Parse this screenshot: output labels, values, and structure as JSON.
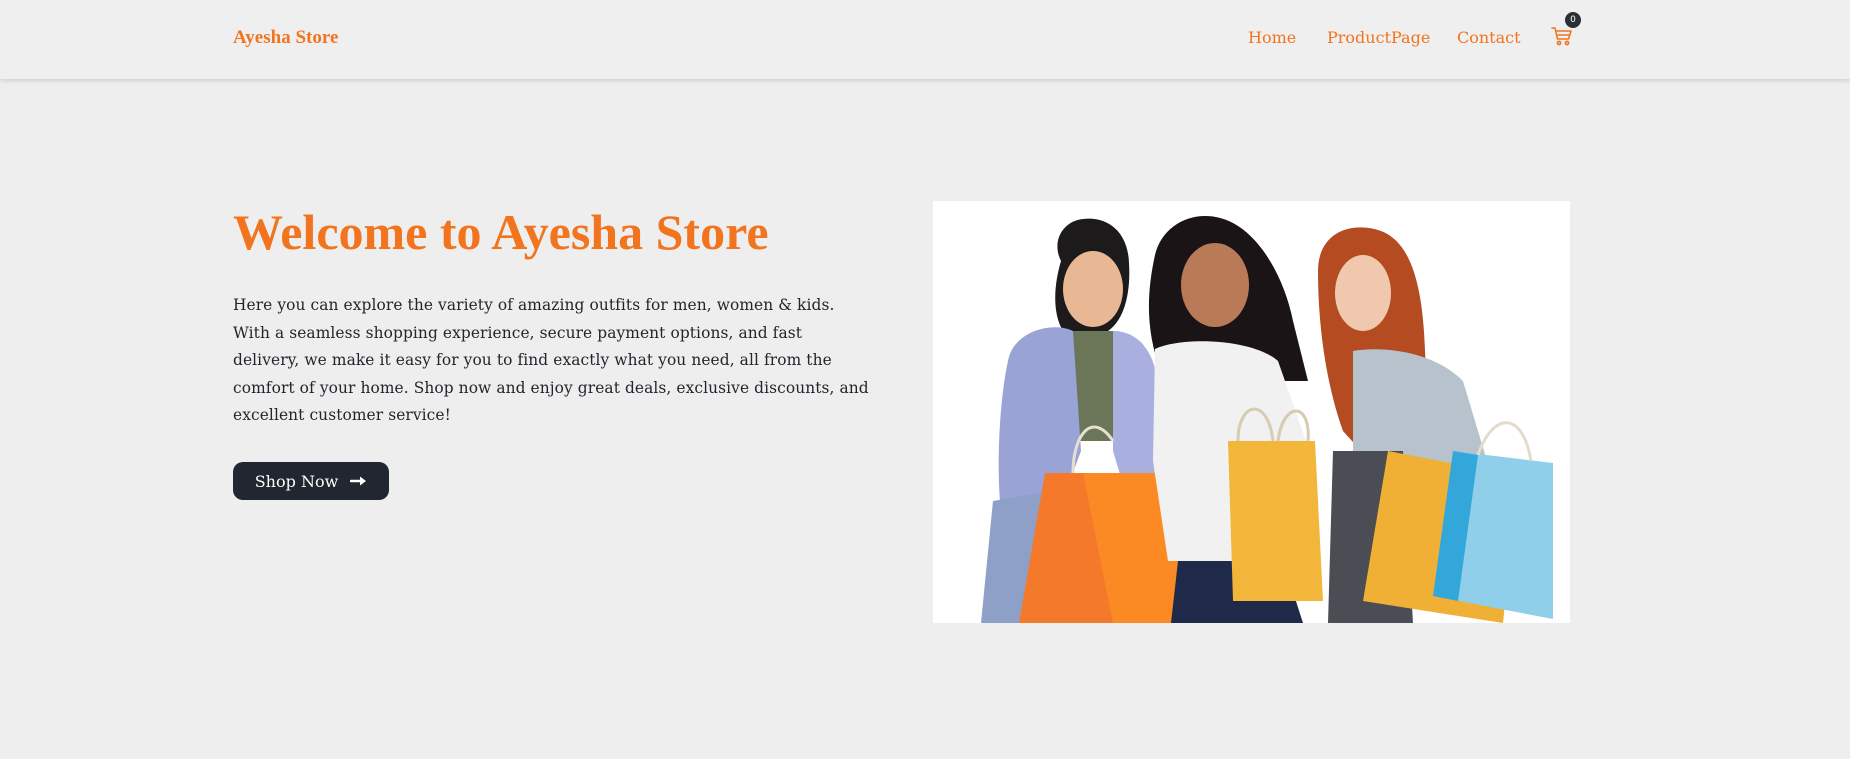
{
  "navbar": {
    "brand": "Ayesha Store",
    "links": [
      {
        "label": "Home"
      },
      {
        "label": "ProductPage"
      },
      {
        "label": "Contact"
      }
    ],
    "cart": {
      "icon": "shopping-cart-icon",
      "count": "0"
    }
  },
  "hero": {
    "title": "Welcome to Ayesha Store",
    "description": "Here you can explore the variety of amazing outfits for men, women & kids. With a seamless shopping experience, secure payment options, and fast delivery, we make it easy for you to find exactly what you need, all from the comfort of your home. Shop now and enjoy great deals, exclusive discounts, and excellent customer service!",
    "button": {
      "label": "Shop Now",
      "icon": "arrow-right-icon"
    },
    "image": {
      "icon": "shopping-women-illustration"
    }
  },
  "colors": {
    "accent": "#f2741e",
    "dark": "#212630",
    "background": "#eeeeee"
  }
}
